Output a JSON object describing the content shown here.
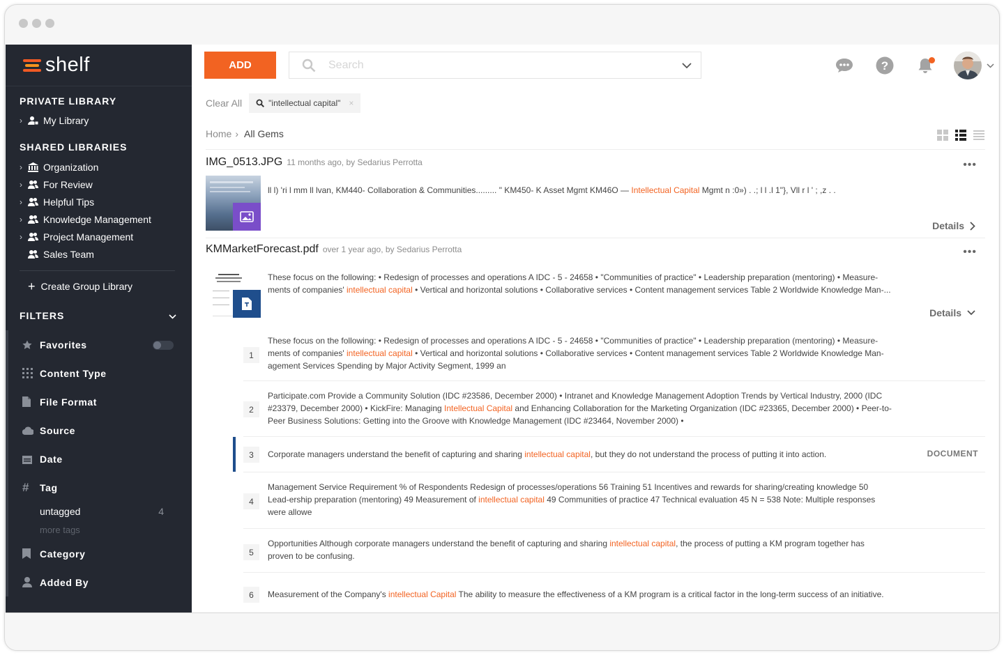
{
  "brand": {
    "name": "shelf"
  },
  "sidebar": {
    "private_title": "PRIVATE LIBRARY",
    "private_items": [
      {
        "label": "My Library"
      }
    ],
    "shared_title": "SHARED LIBRARIES",
    "shared_items": [
      {
        "label": "Organization"
      },
      {
        "label": "For Review"
      },
      {
        "label": "Helpful Tips"
      },
      {
        "label": "Knowledge Management"
      },
      {
        "label": "Project Management"
      },
      {
        "label": "Sales Team"
      }
    ],
    "create_label": "Create Group Library",
    "filters_title": "FILTERS",
    "filters": [
      {
        "label": "Favorites"
      },
      {
        "label": "Content Type"
      },
      {
        "label": "File Format"
      },
      {
        "label": "Source"
      },
      {
        "label": "Date"
      },
      {
        "label": "Tag"
      },
      {
        "label": "Category"
      },
      {
        "label": "Added By"
      }
    ],
    "tags": [
      {
        "label": "untagged",
        "count": "4"
      }
    ],
    "more_tags": "more tags"
  },
  "toolbar": {
    "add_label": "ADD",
    "search_placeholder": "Search"
  },
  "query": {
    "clear_all": "Clear All",
    "chip": "\"intellectual capital\""
  },
  "breadcrumb": {
    "home": "Home",
    "current": "All Gems"
  },
  "gems": [
    {
      "name": "IMG_0513.JPG",
      "meta": "11 months ago, by Sedarius Perrotta",
      "snippet_pre": "ll l) 'ri l mm ll lvan, KM440- Collaboration & Communities......... \" KM450- K Asset Mgmt KM46O — ",
      "snippet_hl": "Intellectual Capital",
      "snippet_post": " Mgmt n :0») . .; l l .l 1\"}, Vll r l ' ; ,z . .",
      "details": "Details"
    },
    {
      "name": "KMMarketForecast.pdf",
      "meta": "over 1 year ago, by Sedarius Perrotta",
      "snippet_pre": "These focus on the following: • Redesign of processes and operations A IDC - 5 - 24658 • \"Communities of practice\" • Leadership preparation (mentoring) • Measure-ments of companies' ",
      "snippet_hl": "intellectual capital",
      "snippet_post": " • Vertical and horizontal solutions • Collaborative services • Content management services Table 2 Worldwide Knowledge Man-...",
      "details": "Details"
    }
  ],
  "results": [
    {
      "num": "1",
      "pre": "These focus on the following: • Redesign of processes and operations A IDC - 5 - 24658 • \"Communities of practice\" • Leadership preparation (mentoring) • Measure-ments of companies' ",
      "hl": "intellectual capital",
      "post": " • Vertical and horizontal solutions • Collaborative services • Content management services Table 2 Worldwide Knowledge Man-agement Services Spending by Major Activity Segment, 1999 an",
      "type": ""
    },
    {
      "num": "2",
      "pre": "Participate.com Provide a Community Solution (IDC #23586, December 2000) • Intranet and Knowledge Management Adoption Trends by Vertical Industry, 2000 (IDC #23379, December 2000) • KickFire: Managing ",
      "hl": "Intellectual Capital",
      "post": " and Enhancing Collaboration for the Marketing Organization (IDC #23365, December 2000) • Peer-to-Peer Business Solutions: Getting into the Groove with Knowledge Management (IDC #23464, November 2000) •",
      "type": ""
    },
    {
      "num": "3",
      "pre": "Corporate managers understand the benefit of capturing and sharing ",
      "hl": "intellectual capital",
      "post": ", but they do not understand the process of putting it into action.",
      "type": "DOCUMENT"
    },
    {
      "num": "4",
      "pre": "Management Service Requirement % of Respondents Redesign of processes/operations 56 Training 51 Incentives and rewards for sharing/creating knowledge 50 Lead-ership preparation (mentoring) 49 Measurement of ",
      "hl": "intellectual capital",
      "post": " 49 Communities of practice 47 Technical evaluation 45 N = 538 Note: Multiple responses were allowe",
      "type": ""
    },
    {
      "num": "5",
      "pre": "Opportunities Although corporate managers understand the benefit of capturing and sharing ",
      "hl": "intellectual capital",
      "post": ", the process of putting a KM program together has proven to be confusing.",
      "type": ""
    },
    {
      "num": "6",
      "pre": "Measurement of the Company's ",
      "hl": "intellectual Capital",
      "post": " The ability to measure the effectiveness of a KM program is a critical factor in the long-term success of an initiative.",
      "type": ""
    }
  ],
  "colors": {
    "accent": "#f26322",
    "sidebar": "#242831",
    "active_marker": "#1f4e8c"
  }
}
